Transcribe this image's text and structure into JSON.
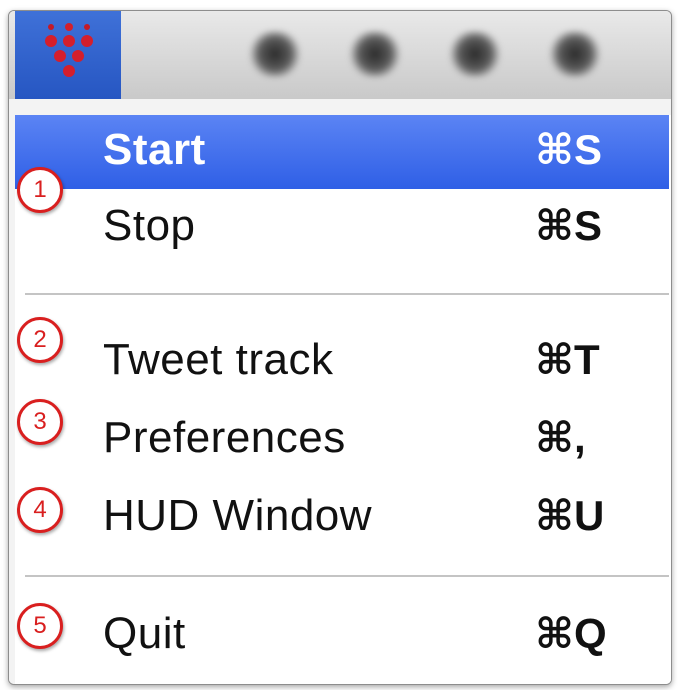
{
  "menu": {
    "items": [
      {
        "label": "Start",
        "shortcut": "⌘S",
        "highlighted": true
      },
      {
        "label": "Stop",
        "shortcut": "⌘S"
      },
      {
        "label": "Tweet track",
        "shortcut": "⌘T"
      },
      {
        "label": "Preferences",
        "shortcut": "⌘,"
      },
      {
        "label": "HUD Window",
        "shortcut": "⌘U"
      },
      {
        "label": "Quit",
        "shortcut": "⌘Q"
      }
    ]
  },
  "callouts": [
    "1",
    "2",
    "3",
    "4",
    "5"
  ],
  "colors": {
    "highlight": "#3b6cf0",
    "callout": "#d91f1f",
    "app_icon": "#d41f2c"
  },
  "icons": {
    "app_icon": "red-dot-pyramid-icon"
  }
}
